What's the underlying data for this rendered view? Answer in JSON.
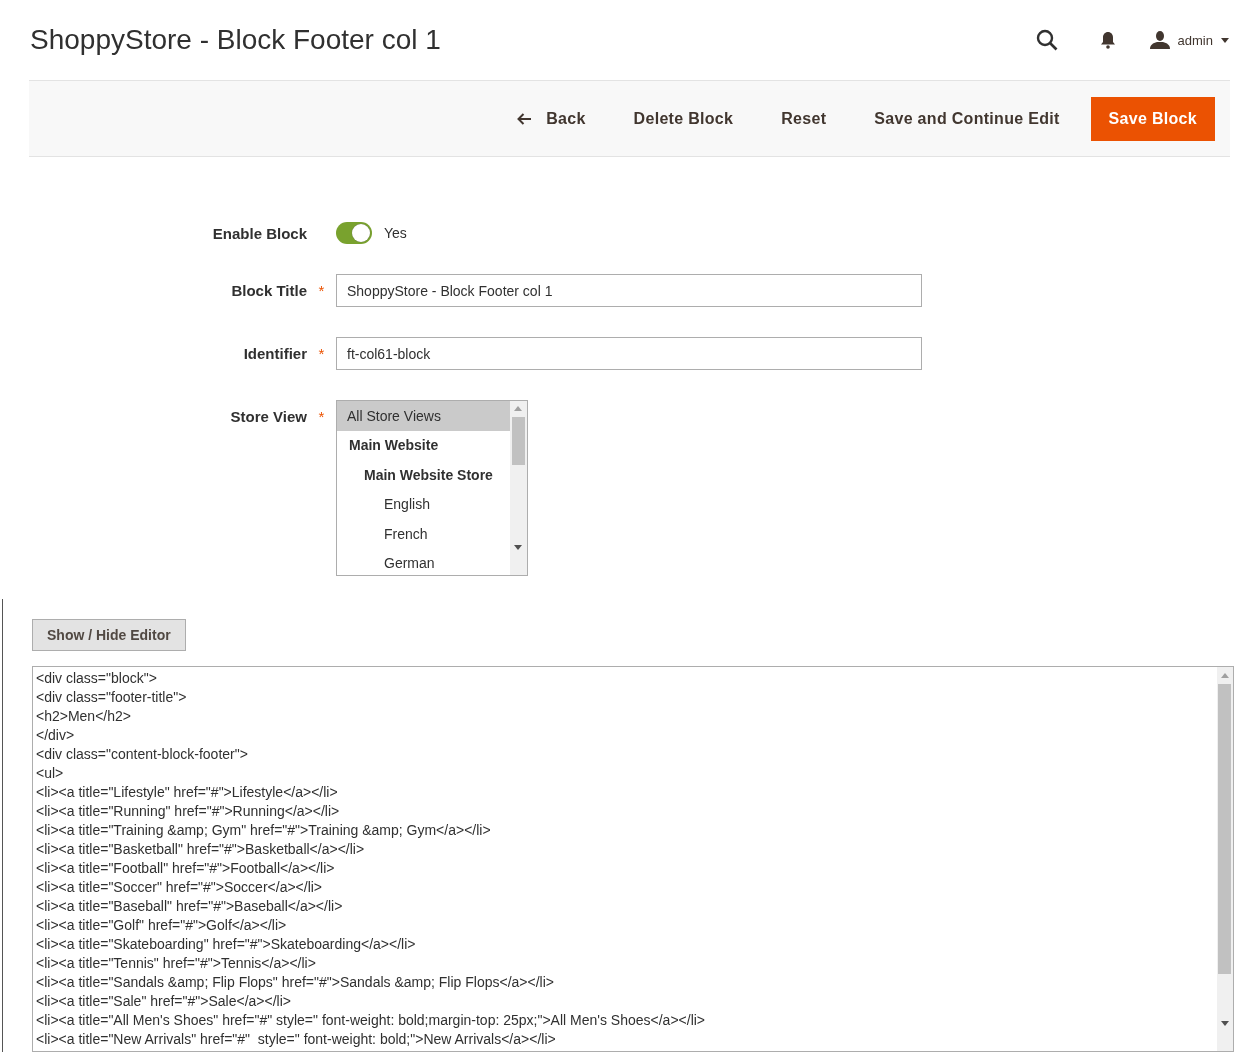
{
  "header": {
    "title": "ShoppyStore - Block Footer col 1",
    "user": "admin"
  },
  "actions": [
    {
      "kind": "back",
      "label": "Back"
    },
    {
      "kind": "plain",
      "label": "Delete Block"
    },
    {
      "kind": "plain",
      "label": "Reset"
    },
    {
      "kind": "plain",
      "label": "Save and Continue Edit"
    },
    {
      "kind": "primary",
      "label": "Save Block"
    }
  ],
  "form": {
    "enable": {
      "label": "Enable Block",
      "on": true,
      "value_label": "Yes"
    },
    "fields": [
      {
        "label": "Block Title",
        "required_mark": "*",
        "value": "ShoppyStore - Block Footer col 1"
      },
      {
        "label": "Identifier",
        "required_mark": "*",
        "value": "ft-col61-block"
      }
    ],
    "store_view": {
      "label": "Store View",
      "required_mark": "*",
      "options": [
        {
          "label": "All Store Views",
          "selected": true,
          "group": false
        },
        {
          "label": "Main Website",
          "selected": false,
          "group": true,
          "children": [
            {
              "label": "Main Website Store",
              "selected": false,
              "group": true,
              "children": [
                {
                  "label": "English",
                  "selected": false,
                  "group": false
                },
                {
                  "label": "French",
                  "selected": false,
                  "group": false
                },
                {
                  "label": "German",
                  "selected": false,
                  "group": false
                }
              ]
            }
          ]
        }
      ]
    }
  },
  "editor": {
    "toggle": "Show / Hide Editor",
    "lines": [
      "<div class=\"block\">",
      "<div class=\"footer-title\">",
      "<h2>Men</h2>",
      "</div>",
      "<div class=\"content-block-footer\">",
      "<ul>",
      "<li><a title=\"Lifestyle\" href=\"#\">Lifestyle</a></li>",
      "<li><a title=\"Running\" href=\"#\">Running</a></li>",
      "<li><a title=\"Training &amp; Gym\" href=\"#\">Training &amp; Gym</a></li>",
      "<li><a title=\"Basketball\" href=\"#\">Basketball</a></li>",
      "<li><a title=\"Football\" href=\"#\">Football</a></li>",
      "<li><a title=\"Soccer\" href=\"#\">Soccer</a></li>",
      "<li><a title=\"Baseball\" href=\"#\">Baseball</a></li>",
      "<li><a title=\"Golf\" href=\"#\">Golf</a></li>",
      "<li><a title=\"Skateboarding\" href=\"#\">Skateboarding</a></li>",
      "<li><a title=\"Tennis\" href=\"#\">Tennis</a></li>",
      "<li><a title=\"Sandals &amp; Flip Flops\" href=\"#\">Sandals &amp; Flip Flops</a></li>",
      "<li><a title=\"Sale\" href=\"#\">Sale</a></li>",
      "<li><a title=\"All Men's Shoes\" href=\"#\" style=\" font-weight: bold;margin-top: 25px;\">All Men's Shoes</a></li>",
      "<li><a title=\"New Arrivals\" href=\"#\"  style=\" font-weight: bold;\">New Arrivals</a></li>"
    ]
  }
}
